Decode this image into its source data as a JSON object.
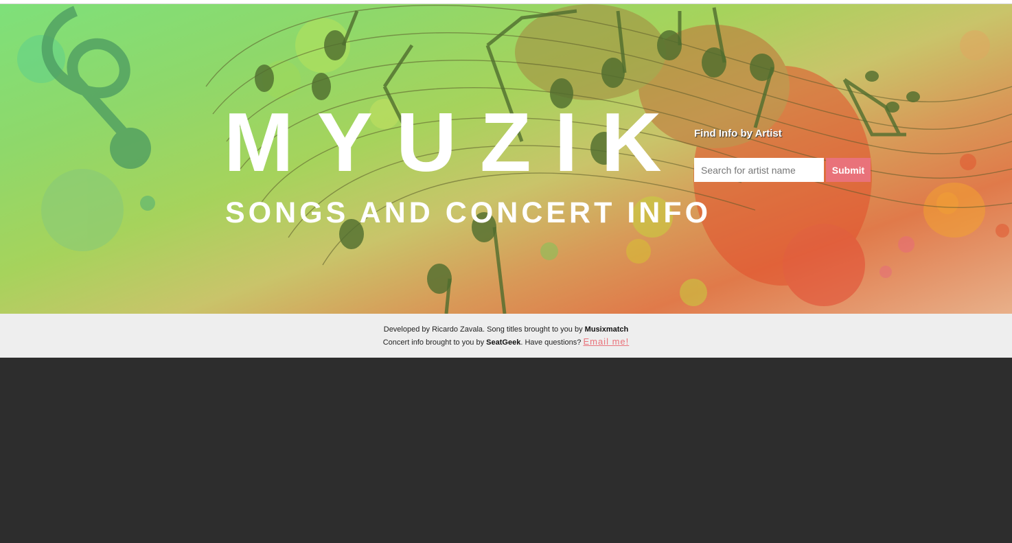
{
  "header": {
    "title": "MYUZIK",
    "subtitle": "SONGS AND CONCERT INFO"
  },
  "search": {
    "heading": "Find Info by Artist",
    "placeholder": "Search for artist name",
    "submit_label": "Submit"
  },
  "footer": {
    "line1_prefix": "Developed by Ricardo Zavala. Song titles brought to you by ",
    "line1_brand": "Musixmatch",
    "line2_prefix": "Concert info brought to you by ",
    "line2_brand": "SeatGeek",
    "line2_middle": ". Have questions? ",
    "email_link": "Email me!"
  },
  "colors": {
    "accent": "#e9727a",
    "footer_bg": "#eeeeee",
    "page_bg": "#2d2d2d"
  },
  "decor": {
    "hero_art": "music-notes-paint-splash"
  }
}
